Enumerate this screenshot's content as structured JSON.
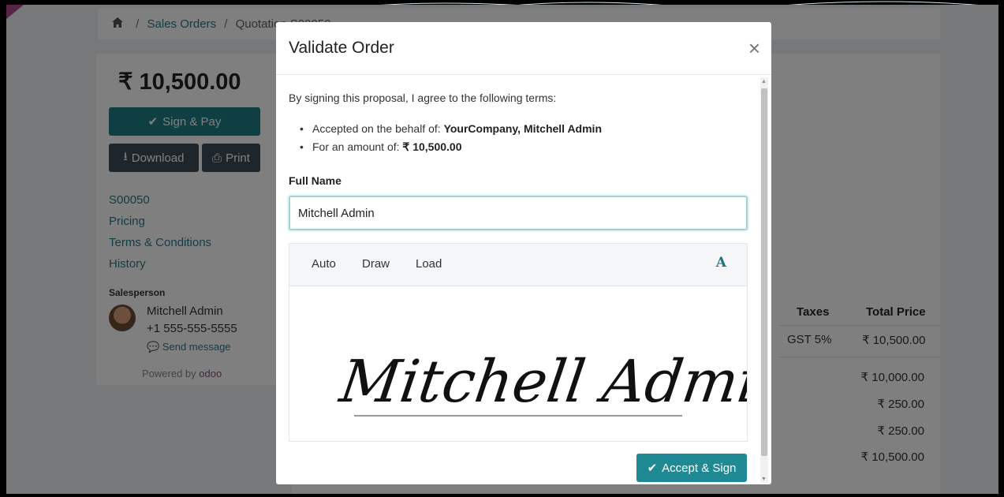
{
  "breadcrumb": {
    "home_icon": "home-icon",
    "items": [
      "Sales Orders",
      "Quotation S00050"
    ]
  },
  "sidebar": {
    "amount": "₹ 10,500.00",
    "sign_pay_label": "Sign & Pay",
    "download_label": "Download",
    "print_label": "Print",
    "links": [
      "S00050",
      "Pricing",
      "Terms & Conditions",
      "History"
    ],
    "salesperson_heading": "Salesperson",
    "salesperson_name": "Mitchell Admin",
    "salesperson_phone": "+1 555-555-5555",
    "send_message_label": "Send message",
    "powered_by": "Powered by",
    "powered_brand": "odoo"
  },
  "order_table": {
    "headers": {
      "taxes": "Taxes",
      "total": "Total Price"
    },
    "row": {
      "taxes": "GST 5%",
      "total": "₹ 10,500.00"
    },
    "summary": [
      "₹ 10,000.00",
      "₹ 250.00",
      "₹ 250.00",
      "₹ 10,500.00"
    ]
  },
  "modal": {
    "title": "Validate Order",
    "close_icon": "close-icon",
    "intro": "By signing this proposal, I agree to the following terms:",
    "accepted_prefix": "Accepted on the behalf of: ",
    "accepted_value": "YourCompany, Mitchell Admin",
    "amount_prefix": "For an amount of: ",
    "amount_value": "₹ 10,500.00",
    "full_name_label": "Full Name",
    "full_name_value": "Mitchell Admin",
    "signature_tabs": [
      "Auto",
      "Draw",
      "Load"
    ],
    "font_selector_label": "A",
    "signature_text": "Mitchell Admin",
    "accept_label": "Accept & Sign"
  },
  "colors": {
    "accent": "#1f8a94",
    "link": "#2b7a8e",
    "dark_button": "#3c4a56"
  }
}
